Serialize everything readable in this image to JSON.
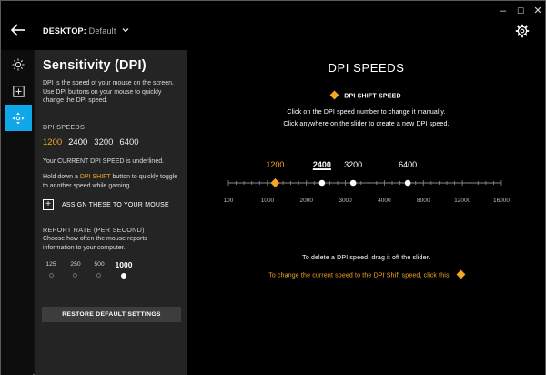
{
  "window": {
    "device_label": "DESKTOP:",
    "profile_label": "Default"
  },
  "rail": {
    "items": [
      {
        "name": "lighting",
        "icon": "sun-icon"
      },
      {
        "name": "assignments",
        "icon": "plus-square-icon"
      },
      {
        "name": "pointer",
        "icon": "move-icon",
        "active": true
      }
    ]
  },
  "panel": {
    "title": "Sensitivity (DPI)",
    "description": "DPI is the speed of your mouse on the screen. Use DPI buttons on your mouse to quickly change the DPI speed.",
    "dpi_label": "DPI SPEEDS",
    "dpi_values": [
      "1200",
      "2400",
      "3200",
      "6400"
    ],
    "current_note": "Your CURRENT DPI SPEED is underlined.",
    "hold_text_1": "Hold down a ",
    "hold_highlight": "DPI SHIFT",
    "hold_text_2": " button to quickly toggle to another speed while gaming.",
    "assign_label": "ASSIGN THESE TO YOUR MOUSE",
    "report_label": "REPORT RATE (PER SECOND)",
    "report_desc": "Choose how often the mouse reports information to your computer.",
    "report_rates": [
      "125",
      "250",
      "500",
      "1000"
    ],
    "report_selected": "1000",
    "restore_label": "RESTORE DEFAULT SETTINGS"
  },
  "main": {
    "title": "DPI SPEEDS",
    "shift_legend": "DPI SHIFT SPEED",
    "instruction_1": "Click on the DPI speed number to change it manually.",
    "instruction_2": "Click anywhere on the slider to create a new DPI speed.",
    "delete_hint": "To delete a DPI speed, drag it off the slider.",
    "shift_hint": "To change the current speed to the DPI Shift speed, click this:"
  },
  "colors": {
    "accent": "#0fa7e8",
    "shift": "#f5a623",
    "background": "#000000",
    "panel": "#242424"
  },
  "chart_data": {
    "type": "scatter",
    "title": "DPI SPEEDS",
    "x_ticks": [
      "100",
      "1000",
      "2000",
      "3000",
      "4000",
      "8000",
      "12000",
      "16000"
    ],
    "points": [
      {
        "label": "1200",
        "value": 1200,
        "tick_index": 1.2,
        "kind": "shift"
      },
      {
        "label": "2400",
        "value": 2400,
        "tick_index": 2.4,
        "kind": "current"
      },
      {
        "label": "3200",
        "value": 3200,
        "tick_index": 3.2,
        "kind": "normal"
      },
      {
        "label": "6400",
        "value": 6400,
        "tick_index": 4.6,
        "kind": "normal"
      }
    ]
  }
}
